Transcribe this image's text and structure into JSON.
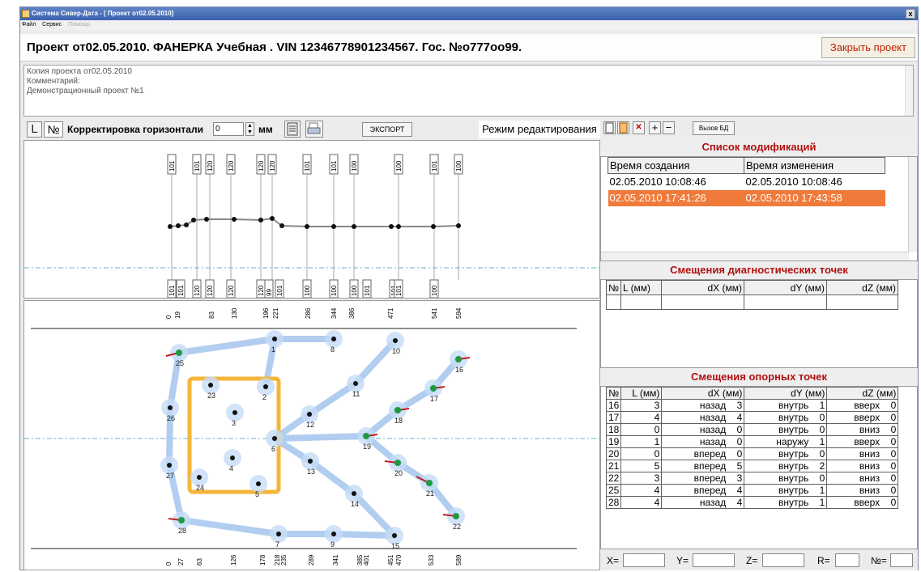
{
  "window": {
    "title": "Система Сивер-Дата - [ Проект от02.05.2010]",
    "close": "x"
  },
  "menu": {
    "items": [
      "Файл",
      "Сервис"
    ],
    "disabled": "Помощь"
  },
  "project": {
    "title": "Проект от02.05.2010.  ФАНЕРКА Учебная . VIN 12346778901234567. Гос. №о777оо99.",
    "close_button": "Закрыть проект"
  },
  "comment": {
    "lines": [
      "Копия проекта от02.05.2010",
      "Комментарий:",
      "Демонстрационный проект №1"
    ]
  },
  "toolbar": {
    "btn_l": "L",
    "btn_no": "№",
    "correction_label": "Корректировка горизонтали",
    "correction_value": "0",
    "unit": "мм",
    "export": "ЭКСПОРТ",
    "mode": "Режим редактирования"
  },
  "right_toolbar": {
    "db_button": "Вызов БД"
  },
  "modifications": {
    "title": "Список модификаций",
    "columns": [
      "Время создания",
      "Время изменения"
    ],
    "rows": [
      [
        "02.05.2010 10:08:46",
        "02.05.2010 10:08:46"
      ],
      [
        "02.05.2010 17:41:26",
        "02.05.2010 17:43:58"
      ]
    ],
    "selected_row": 1
  },
  "diagnostic": {
    "title": "Смещения диагностических точек",
    "columns": [
      "№",
      "L (мм)",
      "dX (мм)",
      "dY (мм)",
      "dZ (мм)"
    ]
  },
  "reference": {
    "title": "Смещения опорных точек",
    "columns": [
      "№",
      "L (мм)",
      "dX (мм)",
      "",
      "dY (мм)",
      "",
      "dZ (мм)",
      ""
    ],
    "rows": [
      [
        "16",
        "3",
        "назад",
        "3",
        "внутрь",
        "1",
        "вверх",
        "0"
      ],
      [
        "17",
        "4",
        "назад",
        "4",
        "внутрь",
        "0",
        "вверх",
        "0"
      ],
      [
        "18",
        "0",
        "назад",
        "0",
        "внутрь",
        "0",
        "вниз",
        "0"
      ],
      [
        "19",
        "1",
        "назад",
        "0",
        "наружу",
        "1",
        "вверх",
        "0"
      ],
      [
        "20",
        "0",
        "вперед",
        "0",
        "внутрь",
        "0",
        "вниз",
        "0"
      ],
      [
        "21",
        "5",
        "вперед",
        "5",
        "внутрь",
        "2",
        "вниз",
        "0"
      ],
      [
        "22",
        "3",
        "вперед",
        "3",
        "внутрь",
        "0",
        "вниз",
        "0"
      ],
      [
        "25",
        "4",
        "вперед",
        "4",
        "внутрь",
        "1",
        "вниз",
        "0"
      ],
      [
        "28",
        "4",
        "назад",
        "4",
        "внутрь",
        "1",
        "вверх",
        "0"
      ]
    ]
  },
  "status": {
    "x": "X=",
    "y": "Y=",
    "z": "Z=",
    "r": "R=",
    "n": "№="
  },
  "side_view": {
    "top_labels": [
      "101",
      "101",
      "120",
      "120",
      "120",
      "120",
      "101",
      "101",
      "100",
      "100",
      "101",
      "100"
    ],
    "bottom_labels": [
      "101",
      "101",
      "120",
      "120",
      "120",
      "120",
      "99",
      "101",
      "100",
      "100",
      "100",
      "101",
      "101",
      "101",
      "100"
    ]
  },
  "plan_view": {
    "top_ticks": [
      "0",
      "19",
      "83",
      "130",
      "196",
      "221",
      "286",
      "344",
      "386",
      "471",
      "541",
      "594"
    ],
    "bottom_ticks": [
      "0",
      "27",
      "63",
      "126",
      "178",
      "218",
      "235",
      "289",
      "341",
      "385",
      "401",
      "451",
      "470",
      "533",
      "589"
    ],
    "points": [
      {
        "id": "1"
      },
      {
        "id": "2"
      },
      {
        "id": "3"
      },
      {
        "id": "4"
      },
      {
        "id": "5"
      },
      {
        "id": "6"
      },
      {
        "id": "7"
      },
      {
        "id": "8"
      },
      {
        "id": "9"
      },
      {
        "id": "10"
      },
      {
        "id": "11"
      },
      {
        "id": "12"
      },
      {
        "id": "13"
      },
      {
        "id": "14"
      },
      {
        "id": "15"
      },
      {
        "id": "16"
      },
      {
        "id": "17"
      },
      {
        "id": "18"
      },
      {
        "id": "19"
      },
      {
        "id": "20"
      },
      {
        "id": "21"
      },
      {
        "id": "22"
      },
      {
        "id": "23"
      },
      {
        "id": "24"
      },
      {
        "id": "25"
      },
      {
        "id": "26"
      },
      {
        "id": "27"
      },
      {
        "id": "28"
      }
    ]
  },
  "colors": {
    "accent_red": "#b01010",
    "selected_row": "#f07a3a",
    "frame": "#f5b53a",
    "ref_point": "#1f9a40",
    "track": "#a8c8ee"
  }
}
